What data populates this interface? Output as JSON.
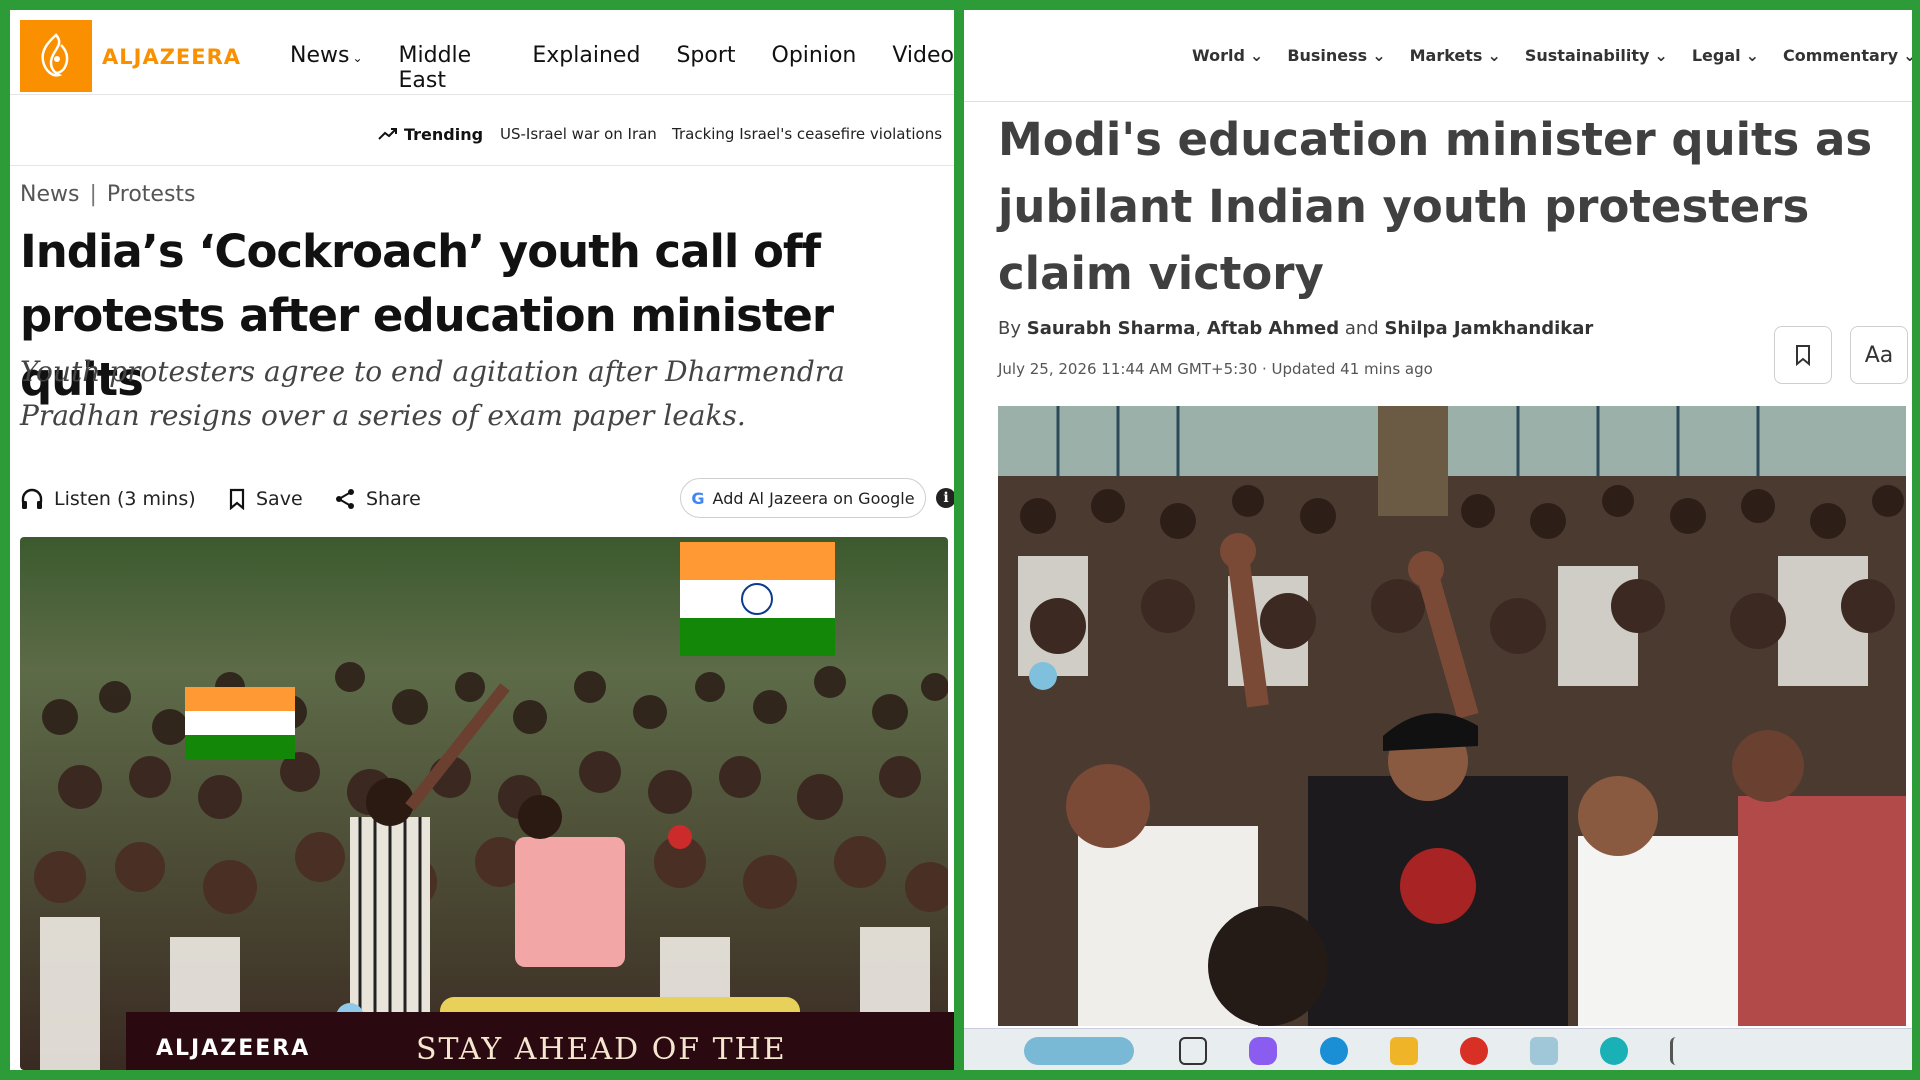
{
  "left": {
    "brand": {
      "wordmark": "ALJAZEERA",
      "color": "#fa9000"
    },
    "nav": [
      {
        "label": "News",
        "has_dropdown": true
      },
      {
        "label": "Middle East",
        "has_dropdown": false
      },
      {
        "label": "Explained",
        "has_dropdown": false
      },
      {
        "label": "Sport",
        "has_dropdown": false
      },
      {
        "label": "Opinion",
        "has_dropdown": false
      },
      {
        "label": "Video",
        "has_dropdown": false
      }
    ],
    "trending": {
      "label": "Trending",
      "items": [
        "US-Israel war on Iran",
        "Tracking Israel's ceasefire violations"
      ]
    },
    "breadcrumb": {
      "section": "News",
      "subsection": "Protests",
      "separator": "|"
    },
    "headline": "India’s ‘Cockroach’ youth call off protests after education minister quits",
    "subheadline": "Youth protesters agree to end agitation after Dharmendra Pradhan resigns over a series of exam paper leaks.",
    "actions": {
      "listen": "Listen (3 mins)",
      "save": "Save",
      "share": "Share",
      "google": "Add Al Jazeera on Google",
      "info": "i"
    },
    "banner": {
      "logo": "ALJAZEERA",
      "text": "STAY AHEAD OF THE HEADLINES"
    }
  },
  "right": {
    "nav": [
      {
        "label": "World"
      },
      {
        "label": "Business"
      },
      {
        "label": "Markets"
      },
      {
        "label": "Sustainability"
      },
      {
        "label": "Legal"
      },
      {
        "label": "Commentary"
      }
    ],
    "headline": "Modi's education minister quits as jubilant Indian youth protesters claim victory",
    "byline": {
      "prefix": "By",
      "author1": "Saurabh Sharma",
      "author2": "Aftab Ahmed",
      "conj": "and",
      "author3": "Shilpa Jamkhandikar"
    },
    "dateline": "July 25, 2026 11:44 AM GMT+5:30 · Updated 41 mins ago",
    "font_button": "Aa"
  },
  "colors": {
    "aj_orange": "#fa9000",
    "india_saffron": "#ff9933",
    "india_green": "#138808",
    "banner_bg": "#2a0a10"
  }
}
